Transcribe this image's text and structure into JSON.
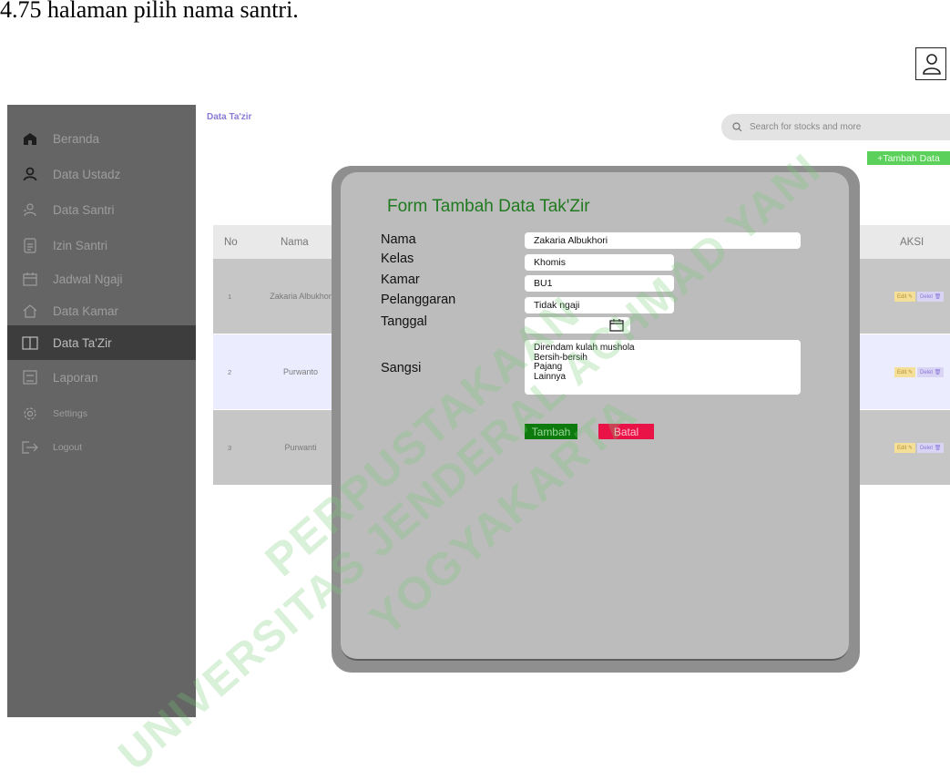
{
  "caption": "4.75 halaman pilih nama santri.",
  "topbar": {
    "user_icon": "user-icon"
  },
  "sidebar": {
    "items": [
      {
        "label": "Beranda",
        "icon": "home-icon"
      },
      {
        "label": "Data Ustadz",
        "icon": "user-icon"
      },
      {
        "label": "Data Santri",
        "icon": "users-icon"
      },
      {
        "label": "Izin Santri",
        "icon": "document-icon"
      },
      {
        "label": "Jadwal Ngaji",
        "icon": "calendar-icon"
      },
      {
        "label": "Data Kamar",
        "icon": "house-icon"
      },
      {
        "label": "Data Ta'Zir",
        "icon": "book-icon"
      },
      {
        "label": "Laporan",
        "icon": "report-icon"
      },
      {
        "label": "Settings",
        "icon": "gear-icon"
      },
      {
        "label": "Logout",
        "icon": "logout-icon"
      }
    ],
    "active": "Data Ta'Zir"
  },
  "main": {
    "title": "Data Ta'zir",
    "search_placeholder": "Search for stocks and more",
    "add_button": "+Tambah Data",
    "table": {
      "headers": {
        "no": "No",
        "nama": "Nama",
        "aksi": "AKSI"
      },
      "rows": [
        {
          "no": "1",
          "nama": "Zakaria Albukhor"
        },
        {
          "no": "2",
          "nama": "Purwanto"
        },
        {
          "no": "3",
          "nama": "Purwanti"
        }
      ],
      "edit_label": "Edit",
      "delete_label": "Delet"
    }
  },
  "modal": {
    "title": "Form Tambah Data Tak'Zir",
    "labels": {
      "nama": "Nama",
      "kelas": "Kelas",
      "kamar": "Kamar",
      "pelanggaran": "Pelanggaran",
      "tanggal": "Tanggal",
      "sangsi": "Sangsi"
    },
    "values": {
      "nama": "Zakaria Albukhori",
      "kelas": "Khomis",
      "kamar": "BU1",
      "pelanggaran": "Tidak ngaji",
      "tanggal": ""
    },
    "sangsi_options": [
      "Direndam kulah mushola",
      "Bersih-bersih",
      "Pajang",
      "Lainnya"
    ],
    "submit_label": "Tambah",
    "cancel_label": "Batal"
  },
  "watermark": {
    "line1": "UNIVERSITAS JENDERAL ACHMAD YANI",
    "line2": "PERPUSTAKAAN",
    "line3": "YOGYAKARTA"
  }
}
